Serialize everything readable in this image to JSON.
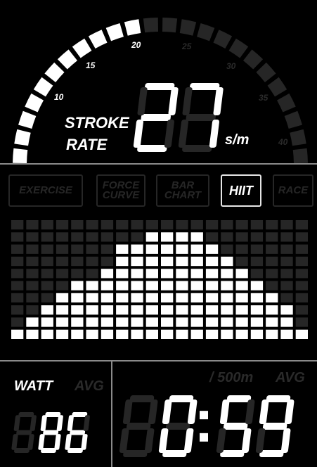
{
  "stroke_rate": {
    "label_line1": "STROKE",
    "label_line2": "RATE",
    "value": "27",
    "unit": "s/m",
    "ticks": [
      "10",
      "15",
      "20",
      "25",
      "30",
      "35",
      "40"
    ],
    "active_tick_max": "20",
    "gauge_fraction_lit": 0.46
  },
  "modes": [
    {
      "label_line1": "EXERCISE",
      "label_line2": "",
      "active": false
    },
    {
      "label_line1": "FORCE",
      "label_line2": "CURVE",
      "active": false
    },
    {
      "label_line1": "BAR",
      "label_line2": "CHART",
      "active": false
    },
    {
      "label_line1": "HIIT",
      "label_line2": "",
      "active": true
    },
    {
      "label_line1": "RACE",
      "label_line2": "",
      "active": false
    }
  ],
  "bar_chart": {
    "columns": 20,
    "rows": 10,
    "heights": [
      1,
      2,
      3,
      4,
      5,
      5,
      6,
      8,
      8,
      9,
      9,
      9,
      9,
      8,
      7,
      6,
      5,
      4,
      3,
      1
    ]
  },
  "watt": {
    "label": "WATT",
    "avg_label": "AVG",
    "value": "86"
  },
  "pace": {
    "unit_label": "/ 500m",
    "avg_label": "AVG",
    "value": "0:59"
  },
  "colors": {
    "lit": "#ffffff",
    "dim": "#262626",
    "divider": "#8a8a8a",
    "background": "#000000"
  }
}
